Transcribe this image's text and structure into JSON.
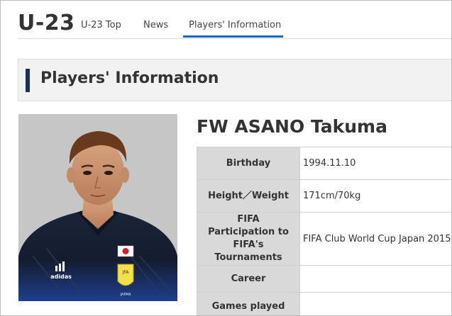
{
  "header": {
    "brand": "U-23",
    "nav": [
      {
        "label": "U-23 Top"
      },
      {
        "label": "News"
      },
      {
        "label": "Players' Information"
      }
    ],
    "active_index": 2,
    "accent_color": "#1d63c8"
  },
  "section": {
    "title": "Players' Information",
    "bar_color": "#1a2f5a"
  },
  "player": {
    "name": "FW ASANO Takuma",
    "photo_jersey_text": "adidas",
    "photo_badge_text": "JFA",
    "photo_badge_sub": "JAPAN",
    "info": [
      {
        "label": "Birthday",
        "value": "1994.11.10"
      },
      {
        "label": "Height／Weight",
        "value": "171cm/70kg"
      },
      {
        "label": "FIFA Participation to FIFA's Tournaments",
        "value": "FIFA Club World Cup Japan 2015"
      },
      {
        "label": "Career",
        "value": ""
      },
      {
        "label": "Games played",
        "value": ""
      }
    ]
  }
}
